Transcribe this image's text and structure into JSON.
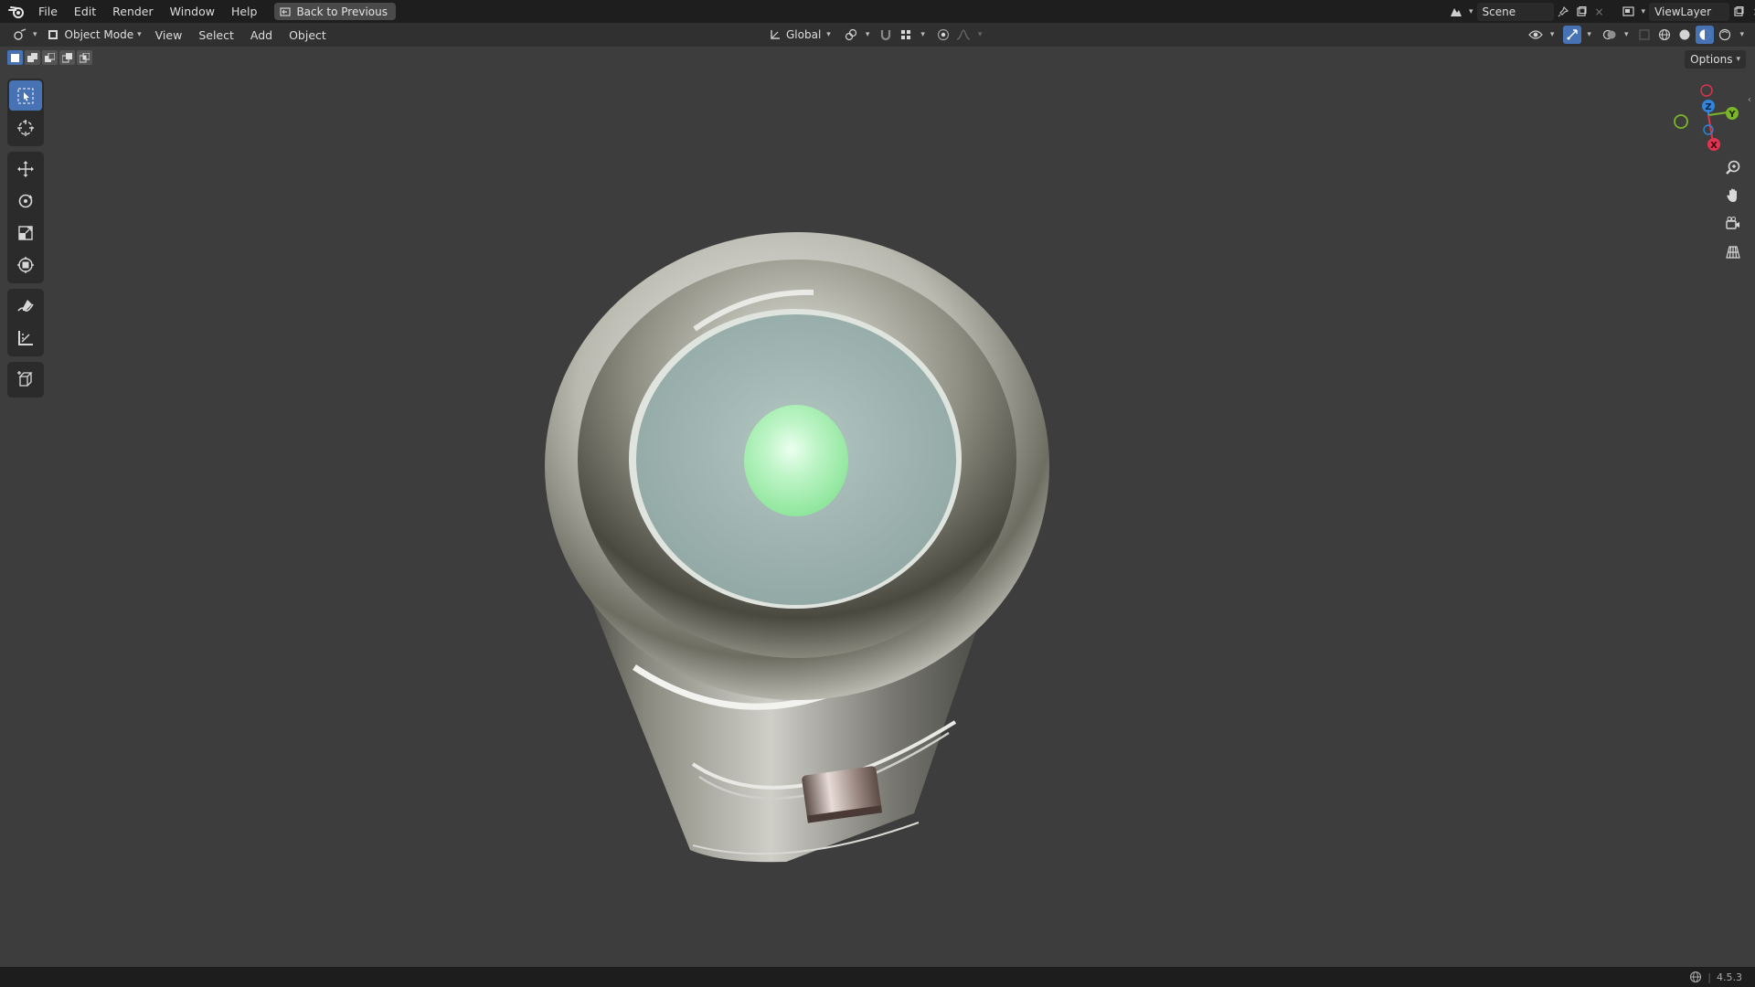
{
  "menu": {
    "items": [
      "File",
      "Edit",
      "Render",
      "Window",
      "Help"
    ],
    "back_button": "Back to Previous"
  },
  "scene": {
    "scene_name": "Scene",
    "view_layer": "ViewLayer"
  },
  "header": {
    "mode": "Object Mode",
    "menus": [
      "View",
      "Select",
      "Add",
      "Object"
    ],
    "orientation": "Global",
    "options": "Options"
  },
  "gizmo_axes": {
    "z": "Z",
    "y": "Y",
    "x": "X"
  },
  "status": {
    "version": "4.5.3"
  },
  "colors": {
    "accent": "#4772b3",
    "viewport_bg": "#3d3d3d",
    "axis_x": "#e0344f",
    "axis_y": "#7db52a",
    "axis_z": "#2e86de"
  }
}
